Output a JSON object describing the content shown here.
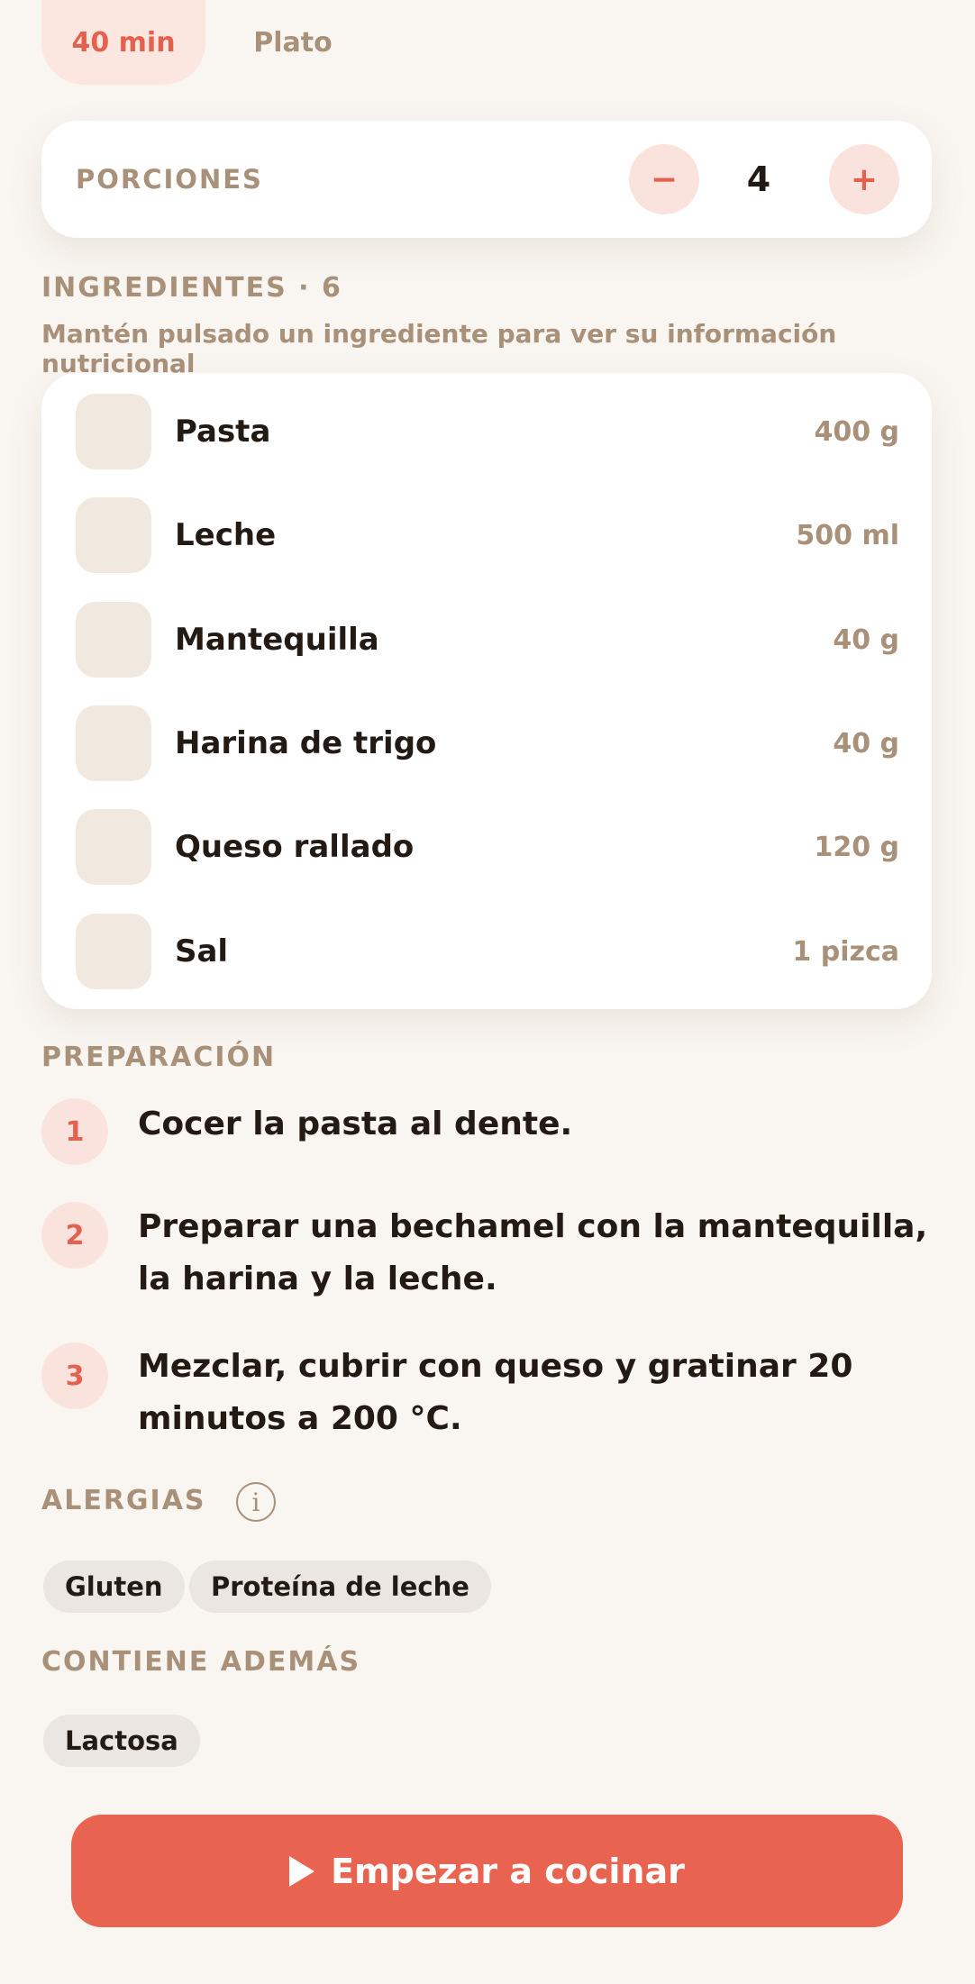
{
  "meta": {
    "time": "40 min",
    "type": "Plato"
  },
  "servings": {
    "label": "PORCIONES",
    "minus": "−",
    "count": "4",
    "plus": "+"
  },
  "ingredients": {
    "title": "INGREDIENTES · 6",
    "hint": "Mantén pulsado un ingrediente para ver su información nutricional",
    "items": [
      {
        "name": "Pasta",
        "qty": "400 g"
      },
      {
        "name": "Leche",
        "qty": "500 ml"
      },
      {
        "name": "Mantequilla",
        "qty": "40 g"
      },
      {
        "name": "Harina de trigo",
        "qty": "40 g"
      },
      {
        "name": "Queso rallado",
        "qty": "120 g"
      },
      {
        "name": "Sal",
        "qty": "1 pizca"
      }
    ]
  },
  "preparation": {
    "title": "PREPARACIÓN",
    "steps": [
      {
        "num": "1",
        "text": "Cocer la pasta al dente."
      },
      {
        "num": "2",
        "text": "Preparar una bechamel con la mantequilla, la harina y la leche."
      },
      {
        "num": "3",
        "text": "Mezclar, cubrir con queso y gratinar 20 minutos a 200 °C."
      }
    ]
  },
  "allergies": {
    "title": "ALERGIAS",
    "info_icon": "info-icon",
    "tags": [
      "Gluten",
      "Proteína de leche"
    ]
  },
  "also_contains": {
    "title": "CONTIENE ADEMÁS",
    "tags": [
      "Lactosa"
    ]
  },
  "cta": {
    "icon": "play-icon",
    "label": "Empezar a cocinar"
  },
  "colors": {
    "accent": "#e86450",
    "accent_soft": "#fbe3dd",
    "muted": "#a89079",
    "background": "#f9f5f0"
  }
}
